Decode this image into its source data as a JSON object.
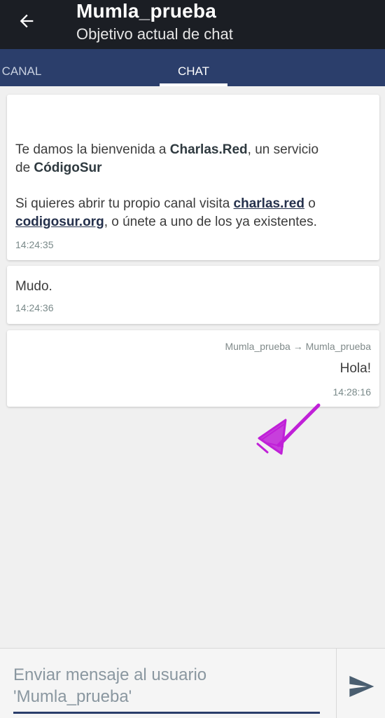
{
  "appbar": {
    "title": "Mumla_prueba",
    "subtitle": "Objetivo actual de chat"
  },
  "tabs": [
    {
      "label": "CANAL",
      "active": false
    },
    {
      "label": "CHAT",
      "active": true
    }
  ],
  "messages": [
    {
      "welcome_prefix": "Te damos la bienvenida a ",
      "welcome_brand": "Charlas.Red",
      "welcome_mid": ", un servicio",
      "welcome_de": "de ",
      "welcome_org": "CódigoSur",
      "visit_prefix": "Si quieres abrir tu propio canal visita ",
      "link1": "charlas.red",
      "visit_mid": " o",
      "link2": "codigosur.org",
      "visit_suffix": ", o únete a uno de los ya existentes.",
      "time": "14:24:35"
    },
    {
      "text": "Mudo.",
      "time": "14:24:36"
    },
    {
      "from_to": "Mumla_prueba → Mumla_prueba",
      "text": "Hola!",
      "time": "14:28:16"
    }
  ],
  "composer": {
    "placeholder_line1": "Enviar mensaje al usuario",
    "placeholder_line2": "'Mumla_prueba'"
  },
  "colors": {
    "appbar": "#1b1e24",
    "tabbar": "#2b3e6b",
    "annotation": "#c020d8"
  },
  "icons": {
    "back": "arrow-back-icon",
    "send": "send-icon",
    "annotation": "annotation-arrow-icon"
  }
}
